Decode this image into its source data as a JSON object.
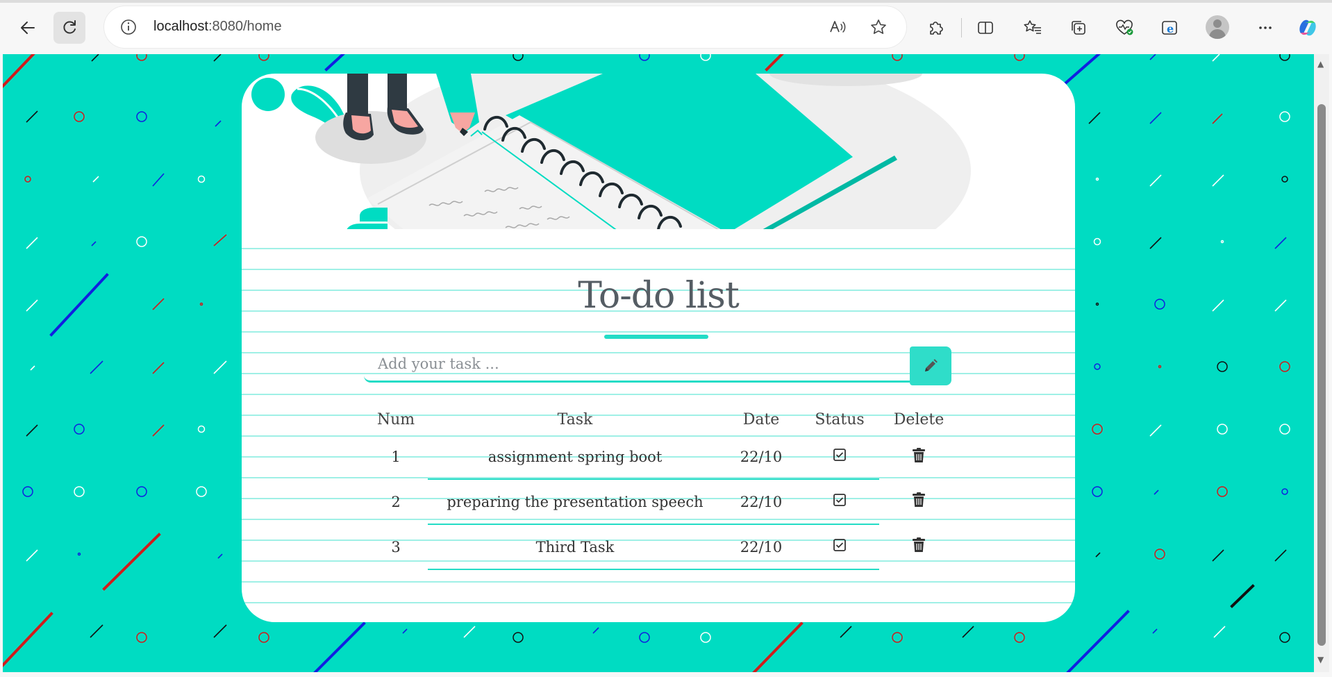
{
  "browser": {
    "url_host": "localhost",
    "url_path": ":8080/home"
  },
  "icons": {
    "back": "back-arrow-icon",
    "refresh": "refresh-icon",
    "info": "info-icon",
    "read_aloud": "read-aloud-icon",
    "favorite": "star-icon",
    "extensions": "puzzle-icon",
    "split_screen": "split-screen-icon",
    "favorites": "favorites-list-icon",
    "collections": "collections-icon",
    "health": "browser-essentials-icon",
    "ie_mode": "ie-mode-icon",
    "profile": "profile-avatar",
    "more": "more-dots-icon",
    "copilot": "copilot-icon",
    "edit": "pencil-icon",
    "status": "checkbox-checked-icon",
    "delete": "trash-icon"
  },
  "page": {
    "title": "To-do list",
    "input_placeholder": "Add your task ...",
    "headers": {
      "num": "Num",
      "task": "Task",
      "date": "Date",
      "status": "Status",
      "delete": "Delete"
    },
    "tasks": [
      {
        "num": "1",
        "task": "assignment spring boot",
        "date": "22/10"
      },
      {
        "num": "2",
        "task": "preparing the presentation speech",
        "date": "22/10"
      },
      {
        "num": "3",
        "task": "Third Task",
        "date": "22/10"
      }
    ]
  },
  "colors": {
    "page_bg": "#00dcc2",
    "accent": "#23dcc6",
    "card": "#ffffff",
    "text": "#333333"
  }
}
